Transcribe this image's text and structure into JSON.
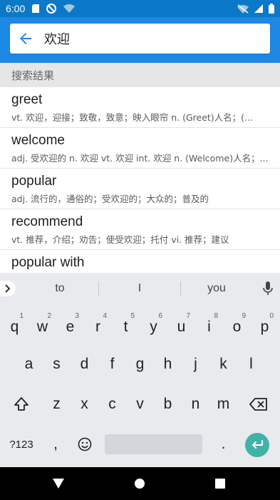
{
  "status_bar": {
    "time": "6:00"
  },
  "search": {
    "back_label": "back",
    "value": "欢迎"
  },
  "section": {
    "title": "搜索结果"
  },
  "results": [
    {
      "word": "greet",
      "definition": "vt. 欢迎，迎接；致敬，致意；映入眼帘 n. (Greet)人名；(..."
    },
    {
      "word": "welcome",
      "definition": "adj. 受欢迎的 n. 欢迎 vt. 欢迎 int. 欢迎 n. (Welcome)人名；..."
    },
    {
      "word": "popular",
      "definition": "adj. 流行的，通俗的；受欢迎的；大众的；普及的"
    },
    {
      "word": "recommend",
      "definition": "vt. 推荐，介绍；劝告；使受欢迎；托付 vi. 推荐；建议"
    },
    {
      "word": "popular with",
      "definition": ""
    }
  ],
  "keyboard": {
    "suggestions": [
      "to",
      "I",
      "you"
    ],
    "row1": [
      "q",
      "w",
      "e",
      "r",
      "t",
      "y",
      "u",
      "i",
      "o",
      "p"
    ],
    "row1_hints": [
      "1",
      "2",
      "3",
      "4",
      "5",
      "6",
      "7",
      "8",
      "9",
      "0"
    ],
    "row2": [
      "a",
      "s",
      "d",
      "f",
      "g",
      "h",
      "j",
      "k",
      "l"
    ],
    "row3": [
      "z",
      "x",
      "c",
      "v",
      "b",
      "n",
      "m"
    ],
    "symbols_label": "?123",
    "comma": ",",
    "period": "."
  },
  "colors": {
    "status_bar": "#0b78c8",
    "app_bar": "#1e88e5",
    "enter_key": "#3fb3a6"
  }
}
